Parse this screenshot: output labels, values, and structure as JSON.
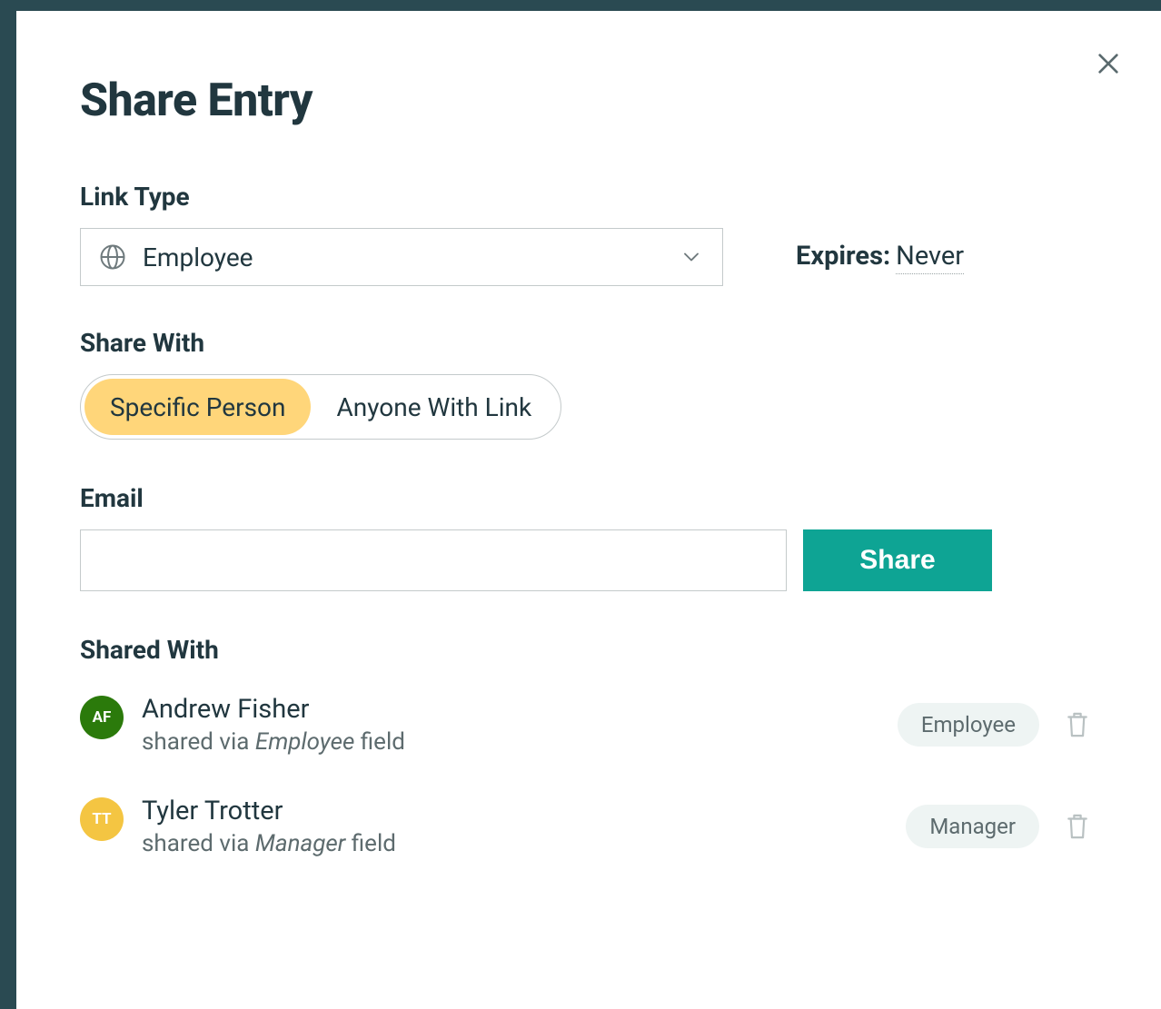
{
  "modal": {
    "title": "Share Entry"
  },
  "link_type": {
    "label": "Link Type",
    "value": "Employee"
  },
  "expires": {
    "label": "Expires:",
    "value": "Never"
  },
  "share_with": {
    "label": "Share With",
    "options": [
      {
        "label": "Specific Person",
        "active": true
      },
      {
        "label": "Anyone With Link",
        "active": false
      }
    ]
  },
  "email": {
    "label": "Email",
    "value": "",
    "share_button": "Share"
  },
  "shared_with": {
    "label": "Shared With",
    "sub_prefix": "shared via ",
    "sub_suffix": " field",
    "people": [
      {
        "initials": "AF",
        "avatar_color": "#2b7a0b",
        "name": "Andrew Fisher",
        "role": "Employee"
      },
      {
        "initials": "TT",
        "avatar_color": "#f4c542",
        "name": "Tyler Trotter",
        "role": "Manager"
      }
    ]
  }
}
